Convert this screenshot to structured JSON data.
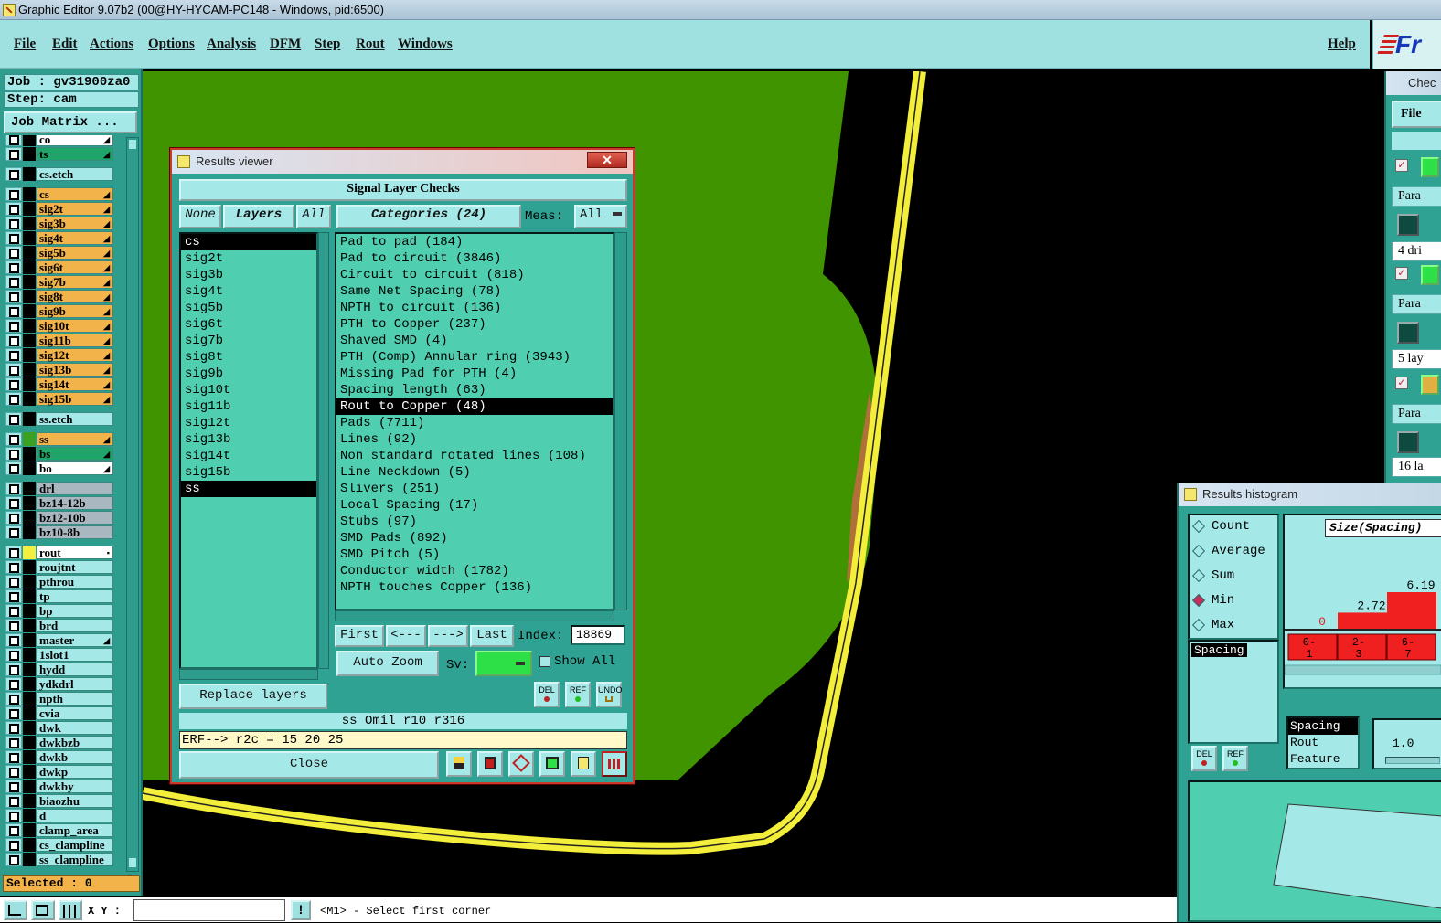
{
  "window": {
    "title": "Graphic Editor 9.07b2 (00@HY-HYCAM-PC148 - Windows, pid:6500)"
  },
  "menu": {
    "file": "File",
    "edit": "Edit",
    "actions": "Actions",
    "options": "Options",
    "analysis": "Analysis",
    "dfm": "DFM",
    "step": "Step",
    "rout": "Rout",
    "windows": "Windows",
    "help": "Help"
  },
  "logo": {
    "text": "Fr"
  },
  "job": {
    "job": "Job : gv31900za0",
    "step": "Step: cam",
    "matrix": "Job Matrix ..."
  },
  "layers": [
    {
      "name": "co",
      "color": "#000000",
      "nameBg": "#ffffff",
      "mark": "◢"
    },
    {
      "name": "ts",
      "color": "#000000",
      "nameBg": "#1fa46a",
      "mark": "◢"
    },
    {
      "name": "cs.etch",
      "color": "#000000",
      "nameBg": "#a5e8e8",
      "mark": ""
    },
    {
      "name": "cs",
      "color": "#000000",
      "nameBg": "#f2b34a",
      "mark": "◢"
    },
    {
      "name": "sig2t",
      "color": "#000000",
      "nameBg": "#f2b34a",
      "mark": "◢"
    },
    {
      "name": "sig3b",
      "color": "#000000",
      "nameBg": "#f2b34a",
      "mark": "◢"
    },
    {
      "name": "sig4t",
      "color": "#000000",
      "nameBg": "#f2b34a",
      "mark": "◢"
    },
    {
      "name": "sig5b",
      "color": "#000000",
      "nameBg": "#f2b34a",
      "mark": "◢"
    },
    {
      "name": "sig6t",
      "color": "#000000",
      "nameBg": "#f2b34a",
      "mark": "◢"
    },
    {
      "name": "sig7b",
      "color": "#000000",
      "nameBg": "#f2b34a",
      "mark": "◢"
    },
    {
      "name": "sig8t",
      "color": "#000000",
      "nameBg": "#f2b34a",
      "mark": "◢"
    },
    {
      "name": "sig9b",
      "color": "#000000",
      "nameBg": "#f2b34a",
      "mark": "◢"
    },
    {
      "name": "sig10t",
      "color": "#000000",
      "nameBg": "#f2b34a",
      "mark": "◢"
    },
    {
      "name": "sig11b",
      "color": "#000000",
      "nameBg": "#f2b34a",
      "mark": "◢"
    },
    {
      "name": "sig12t",
      "color": "#000000",
      "nameBg": "#f2b34a",
      "mark": "◢"
    },
    {
      "name": "sig13b",
      "color": "#000000",
      "nameBg": "#f2b34a",
      "mark": "◢"
    },
    {
      "name": "sig14t",
      "color": "#000000",
      "nameBg": "#f2b34a",
      "mark": "◢"
    },
    {
      "name": "sig15b",
      "color": "#000000",
      "nameBg": "#f2b34a",
      "mark": "◢"
    },
    {
      "name": "ss.etch",
      "color": "#000000",
      "nameBg": "#a5e8e8",
      "mark": ""
    },
    {
      "name": "ss",
      "color": "#3ca020",
      "nameBg": "#f2b34a",
      "mark": "◢"
    },
    {
      "name": "bs",
      "color": "#000000",
      "nameBg": "#1fa46a",
      "mark": "◢"
    },
    {
      "name": "bo",
      "color": "#000000",
      "nameBg": "#ffffff",
      "mark": "◢"
    },
    {
      "name": "drl",
      "color": "#000000",
      "nameBg": "#a9b7c0",
      "mark": ""
    },
    {
      "name": "bz14-12b",
      "color": "#000000",
      "nameBg": "#a9b7c0",
      "mark": ""
    },
    {
      "name": "bz12-10b",
      "color": "#000000",
      "nameBg": "#a9b7c0",
      "mark": ""
    },
    {
      "name": "bz10-8b",
      "color": "#000000",
      "nameBg": "#a9b7c0",
      "mark": ""
    },
    {
      "name": "rout",
      "color": "#f4ee40",
      "nameBg": "#ffffff",
      "mark": "▪"
    },
    {
      "name": "roujtnt",
      "color": "#000000",
      "nameBg": "#a5e8e8",
      "mark": ""
    },
    {
      "name": "pthrou",
      "color": "#000000",
      "nameBg": "#a5e8e8",
      "mark": ""
    },
    {
      "name": "tp",
      "color": "#000000",
      "nameBg": "#a5e8e8",
      "mark": ""
    },
    {
      "name": "bp",
      "color": "#000000",
      "nameBg": "#a5e8e8",
      "mark": ""
    },
    {
      "name": "brd",
      "color": "#000000",
      "nameBg": "#a5e8e8",
      "mark": ""
    },
    {
      "name": "master",
      "color": "#000000",
      "nameBg": "#a5e8e8",
      "mark": "◢"
    },
    {
      "name": "1slot1",
      "color": "#000000",
      "nameBg": "#a5e8e8",
      "mark": ""
    },
    {
      "name": "hydd",
      "color": "#000000",
      "nameBg": "#a5e8e8",
      "mark": ""
    },
    {
      "name": "ydkdrl",
      "color": "#000000",
      "nameBg": "#a5e8e8",
      "mark": ""
    },
    {
      "name": "npth",
      "color": "#000000",
      "nameBg": "#a5e8e8",
      "mark": ""
    },
    {
      "name": "cvia",
      "color": "#000000",
      "nameBg": "#a5e8e8",
      "mark": ""
    },
    {
      "name": "dwk",
      "color": "#000000",
      "nameBg": "#a5e8e8",
      "mark": ""
    },
    {
      "name": "dwkbzb",
      "color": "#000000",
      "nameBg": "#a5e8e8",
      "mark": ""
    },
    {
      "name": "dwkb",
      "color": "#000000",
      "nameBg": "#a5e8e8",
      "mark": ""
    },
    {
      "name": "dwkp",
      "color": "#000000",
      "nameBg": "#a5e8e8",
      "mark": ""
    },
    {
      "name": "dwkby",
      "color": "#000000",
      "nameBg": "#a5e8e8",
      "mark": ""
    },
    {
      "name": "biaozhu",
      "color": "#000000",
      "nameBg": "#a5e8e8",
      "mark": ""
    },
    {
      "name": "d",
      "color": "#000000",
      "nameBg": "#a5e8e8",
      "mark": ""
    },
    {
      "name": "clamp_area",
      "color": "#000000",
      "nameBg": "#a5e8e8",
      "mark": ""
    },
    {
      "name": "cs_clampline",
      "color": "#000000",
      "nameBg": "#a5e8e8",
      "mark": ""
    },
    {
      "name": "ss_clampline",
      "color": "#000000",
      "nameBg": "#a5e8e8",
      "mark": ""
    }
  ],
  "status": {
    "selected": "Selected : 0",
    "xy_label": "X Y :",
    "prompt": "<M1> - Select first corner",
    "excl": "!"
  },
  "results_viewer": {
    "title": "Results viewer",
    "close_x": "✕",
    "header": "Signal Layer Checks",
    "none": "None",
    "layers_btn": "Layers",
    "all_btn": "All",
    "categories_btn": "Categories (24)",
    "meas_label": "Meas:",
    "meas_value": "All",
    "layer_list": [
      "cs",
      "sig2t",
      "sig3b",
      "sig4t",
      "sig5b",
      "sig6t",
      "sig7b",
      "sig8t",
      "sig9b",
      "sig10t",
      "sig11b",
      "sig12t",
      "sig13b",
      "sig14t",
      "sig15b",
      "ss"
    ],
    "categories": [
      "Pad to pad (184)",
      "Pad to circuit (3846)",
      "Circuit to circuit (818)",
      "Same Net Spacing (78)",
      "NPTH to circuit (136)",
      "PTH to Copper (237)",
      "Shaved SMD (4)",
      "PTH (Comp) Annular ring (3943)",
      "Missing Pad for PTH (4)",
      "Spacing length (63)",
      "Rout to Copper (48)",
      "Pads (7711)",
      "Lines (92)",
      "Non standard rotated lines (108)",
      "Line Neckdown (5)",
      "Slivers (251)",
      "Local Spacing (17)",
      "Stubs (97)",
      "SMD Pads (892)",
      "SMD Pitch (5)",
      "Conductor width (1782)",
      "NPTH touches Copper (136)"
    ],
    "selected_category": "Rout to Copper (48)",
    "first": "First",
    "prev": "<---",
    "next": "--->",
    "last": "Last",
    "index_label": "Index:",
    "index_value": "18869",
    "auto_zoom": "Auto Zoom",
    "sv_label": "Sv:",
    "show_all": "Show All",
    "replace_layers": "Replace layers",
    "del": "DEL",
    "ref": "REF",
    "undo": "UNDO",
    "info_line": "ss Omil  r10  r316",
    "erf_line": "ERF--> r2c = 15 20 25",
    "close": "Close"
  },
  "histogram": {
    "title": "Results histogram",
    "options": [
      "Count",
      "Average",
      "Sum",
      "Min",
      "Max"
    ],
    "selected_option": "Min",
    "chart_title": "Size(Spacing)",
    "bar_values": [
      {
        "label": "0",
        "value": 0
      },
      {
        "label": "2.72",
        "value": 2.72
      },
      {
        "label": "6.19",
        "value": 6.19
      }
    ],
    "bins": [
      {
        "top": "0-",
        "bottom": "1"
      },
      {
        "top": "2-",
        "bottom": "3"
      },
      {
        "top": "6-",
        "bottom": "7"
      }
    ],
    "list_item": "Spacing",
    "types": [
      "Spacing",
      "Rout",
      "Feature"
    ],
    "scale_value": "1.0",
    "del": "DEL",
    "ref": "REF"
  },
  "checklist": {
    "title": "Chec",
    "file": "File",
    "rows": [
      {
        "label": "Para",
        "desc": "4 dri"
      },
      {
        "label": "Para",
        "desc": "5 lay"
      },
      {
        "label": "Para",
        "desc": "16 la"
      }
    ]
  }
}
